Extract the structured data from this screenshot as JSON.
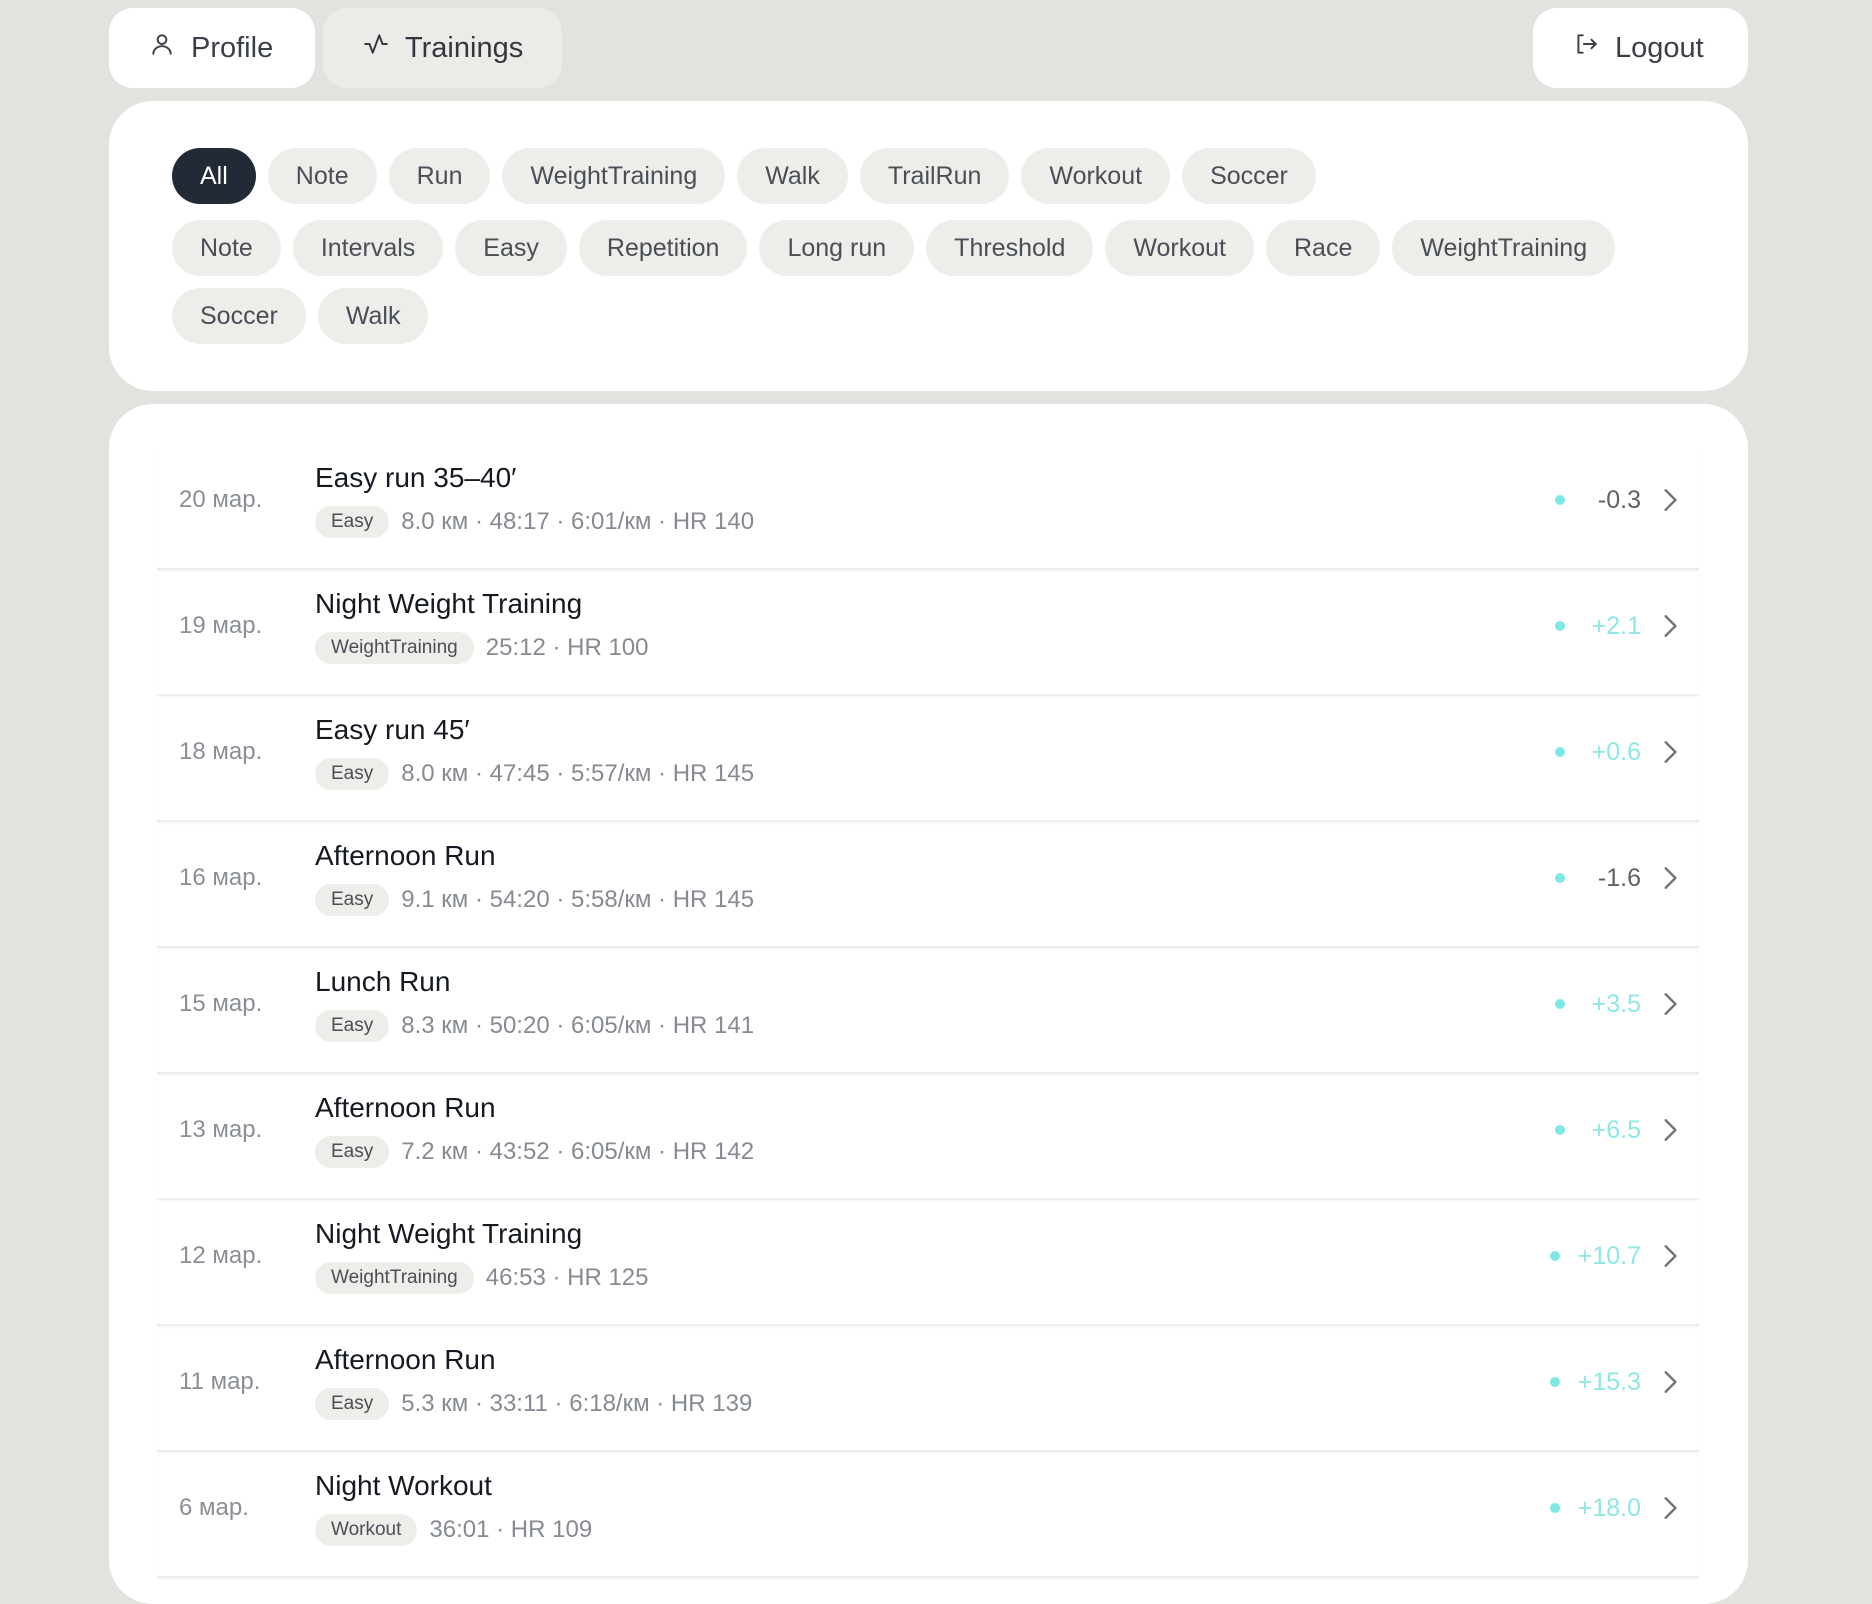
{
  "nav": {
    "profile": "Profile",
    "trainings": "Trainings",
    "logout": "Logout"
  },
  "filters": {
    "row1": [
      "All",
      "Note",
      "Run",
      "WeightTraining",
      "Walk",
      "TrailRun",
      "Workout",
      "Soccer"
    ],
    "row2": [
      "Note",
      "Intervals",
      "Easy",
      "Repetition",
      "Long run",
      "Threshold",
      "Workout",
      "Race",
      "WeightTraining"
    ],
    "row3": [
      "Soccer",
      "Walk"
    ],
    "active": "All"
  },
  "trainings": [
    {
      "date": "20 мар.",
      "title": "Easy run 35–40′",
      "tag": "Easy",
      "meta": "8.0 км · 48:17 · 6:01/км · HR 140",
      "delta": "-0.3"
    },
    {
      "date": "19 мар.",
      "title": "Night Weight Training",
      "tag": "WeightTraining",
      "meta": "25:12 · HR 100",
      "delta": "+2.1"
    },
    {
      "date": "18 мар.",
      "title": "Easy run 45′",
      "tag": "Easy",
      "meta": "8.0 км · 47:45 · 5:57/км · HR 145",
      "delta": "+0.6"
    },
    {
      "date": "16 мар.",
      "title": "Afternoon Run",
      "tag": "Easy",
      "meta": "9.1 км · 54:20 · 5:58/км · HR 145",
      "delta": "-1.6"
    },
    {
      "date": "15 мар.",
      "title": "Lunch Run",
      "tag": "Easy",
      "meta": "8.3 км · 50:20 · 6:05/км · HR 141",
      "delta": "+3.5"
    },
    {
      "date": "13 мар.",
      "title": "Afternoon Run",
      "tag": "Easy",
      "meta": "7.2 км · 43:52 · 6:05/км · HR 142",
      "delta": "+6.5"
    },
    {
      "date": "12 мар.",
      "title": "Night Weight Training",
      "tag": "WeightTraining",
      "meta": "46:53 · HR 125",
      "delta": "+10.7"
    },
    {
      "date": "11 мар.",
      "title": "Afternoon Run",
      "tag": "Easy",
      "meta": "5.3 км · 33:11 · 6:18/км · HR 139",
      "delta": "+15.3"
    },
    {
      "date": "6 мар.",
      "title": "Night Workout",
      "tag": "Workout",
      "meta": "36:01 · HR 109",
      "delta": "+18.0"
    }
  ],
  "colors": {
    "background": "#e2e2de",
    "active_chip": "#232a37",
    "delta_positive": "#8de7e3",
    "delta_negative": "#5d616a",
    "dot": "#7ee8e4"
  },
  "icons": {
    "profile": "user-icon",
    "trainings": "activity-icon",
    "logout": "logout-icon",
    "row_action": "chevron-right-icon"
  }
}
